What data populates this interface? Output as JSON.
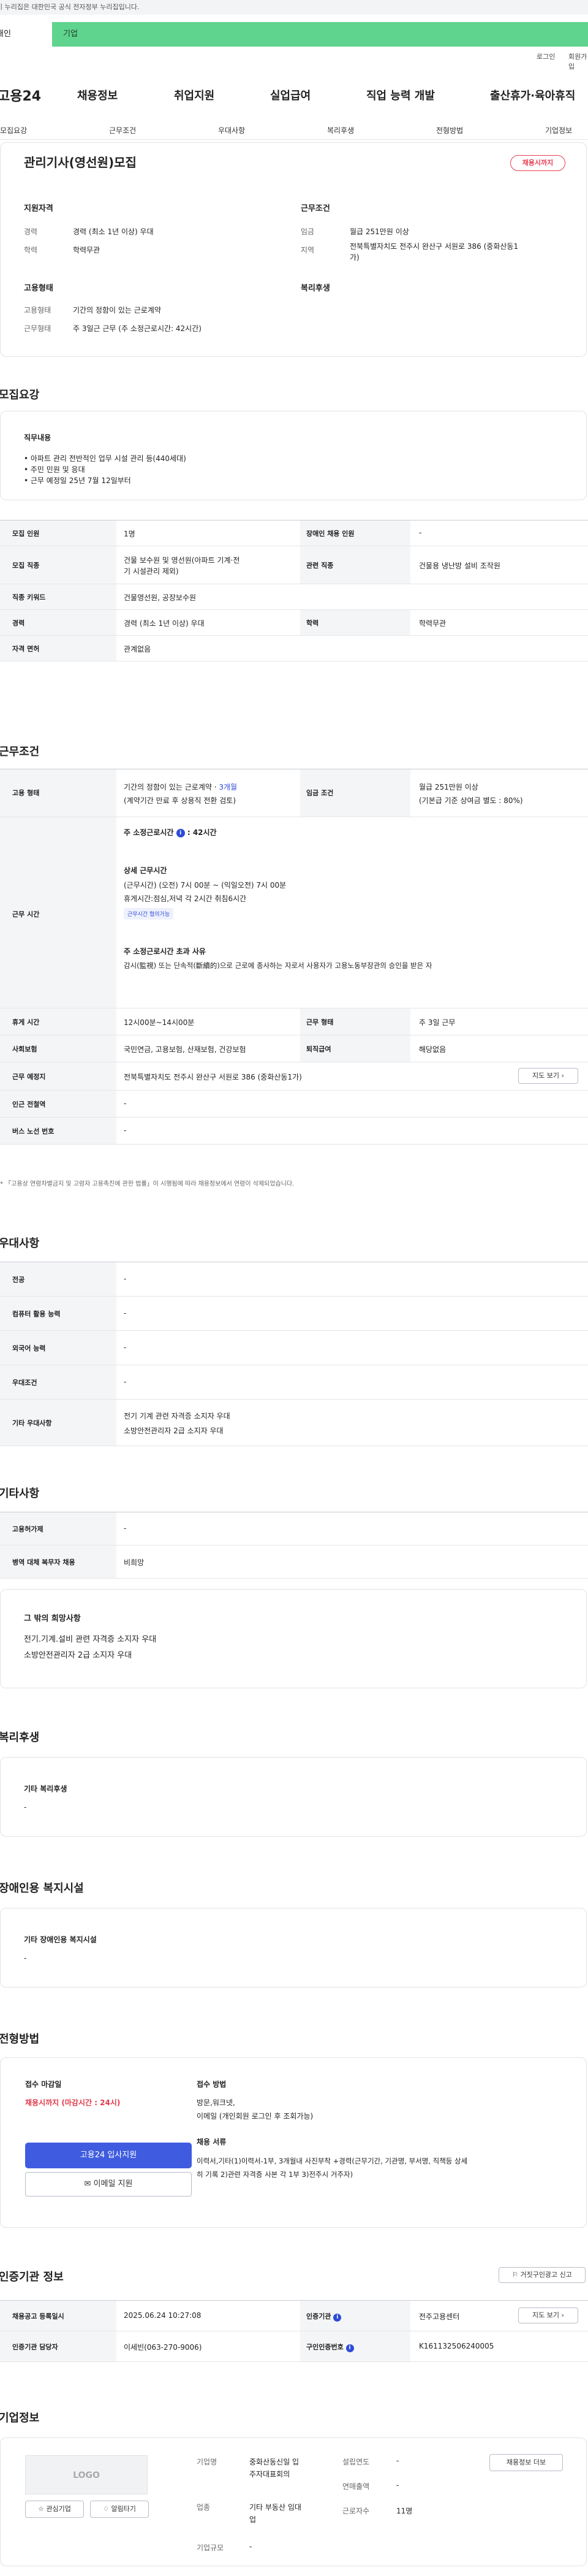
{
  "gov_banner": "이 누리집은 대한민국 공식 전자정부 누리집입니다.",
  "top_tabs": [
    "개인",
    "기업"
  ],
  "util": [
    "로그인",
    "회원가입"
  ],
  "gnb": [
    "고용24",
    "채용정보",
    "취업지원",
    "실업급여",
    "직업 능력 개발",
    "출산휴가·육아휴직"
  ],
  "subnav": [
    "모집요강",
    "근무조건",
    "우대사항",
    "복리후생",
    "전형방법",
    "기업정보"
  ],
  "summary": {
    "title": "관리기사(영선원)모집",
    "badge": "채용시까지",
    "qual_title": "지원자격",
    "qual": [
      {
        "k": "경력",
        "v": "경력 (최소 1년 이상) 우대"
      },
      {
        "k": "학력",
        "v": "학력무관"
      }
    ],
    "cond_title": "근무조건",
    "cond": [
      {
        "k": "임금",
        "v": "월급 251만원 이상"
      },
      {
        "k": "지역",
        "v1": "전북특별자치도 전주시 완산구 서원로 386 (중화산동1",
        "v2": "가)"
      }
    ],
    "emp_title": "고용형태",
    "emp": [
      {
        "k": "고용형태",
        "v": "기간의 정함이 있는 근로계약"
      },
      {
        "k": "근무형태",
        "v": "주 3일근 근무 (주 소정근로시간: 42시간)"
      }
    ],
    "welfare_title": "복리후생"
  },
  "recruit": {
    "title": "모집요강",
    "duty_title": "직무내용",
    "duties": [
      "• 아파트 관리 전반적인 업무 시설 관리 등(440세대)",
      "• 주민 민원 및 응대",
      "• 근무 예정일  25년  7월 12일부터"
    ],
    "rows": [
      {
        "k": "모집 인원",
        "v": "1명",
        "k2": "장애인 채용 인원",
        "v2": "-"
      },
      {
        "k": "모집 직종",
        "v": "건물 보수원 및 영선원(아파트 기계·전기 시설관리 제외)",
        "k2": "관련 직종",
        "v2": "건물용 냉난방 설비 조작원"
      },
      {
        "k": "직종 키워드",
        "v": "건물영선원, 공장보수원"
      },
      {
        "k": "경력",
        "v": "경력 (최소 1년 이상) 우대",
        "k2": "학력",
        "v2": "학력무관"
      },
      {
        "k": "자격 면허",
        "v": "관계없음"
      }
    ]
  },
  "work": {
    "title": "근무조건",
    "emp_k": "고용 형태",
    "emp_v1": "기간의 정함이 있는 근로계약 · ",
    "emp_v1b": "3개월",
    "emp_v2": "(계약기간 만료 후 상용직 전환 검토)",
    "wage_k": "임금 조건",
    "wage_v1": "월급 251만원 이상",
    "wage_v2": "(기본급 기준 상여금 별도 : 80%)",
    "time_k": "근무 시간",
    "time_title": "주 소정근로시간",
    "time_hours": "42시간",
    "detail_title": "상세 근무시간",
    "detail": [
      "(근무시간) (오전) 7시 00분 ~ (익일오전) 7시 00분",
      "휴게시간:점심,저녁 각 2시간 취침6시간"
    ],
    "flex_badge": "근무시간 협의가능",
    "over_title": "주 소정근로시간 초과 사유",
    "over_text": "감시(監視) 또는 단속적(斷續的)으로 근로에 종사하는 자로서 사용자가 고용노동부장관의 승인을 받은 자",
    "rows": [
      {
        "k": "휴게 시간",
        "v": "12시00분~14시00분",
        "k2": "근무 형태",
        "v2": "주 3일 근무"
      },
      {
        "k": "사회보험",
        "v": "국민연금, 고용보험, 산재보험, 건강보험",
        "k2": "퇴직급여",
        "v2": "해당없음"
      }
    ],
    "loc_k": "근무 예정지",
    "loc_v": "전북특별자치도 전주시 완산구 서원로 386 (중화산동1가)",
    "map_btn": "지도 보기",
    "station_k": "인근 전철역",
    "station_v": "-",
    "bus_k": "버스 노선 번호",
    "bus_v": "-",
    "note": "* 「고용상 연령차별금지 및 고령자 고용촉진에 관한 법률」이 시행됨에 따라 채용정보에서 연령이 삭제되었습니다."
  },
  "pref": {
    "title": "우대사항",
    "rows": [
      {
        "k": "전공",
        "v": "-"
      },
      {
        "k": "컴퓨터 활용 능력",
        "v": "-"
      },
      {
        "k": "외국어 능력",
        "v": "-"
      },
      {
        "k": "우대조건",
        "v": "-"
      }
    ],
    "etc_k": "기타 우대사항",
    "etc_v": [
      "전기 기계 관련 자격증 소지자 우대",
      "소방안전관리자 2급 소지자 우대"
    ]
  },
  "other": {
    "title": "기타사항",
    "rows": [
      {
        "k": "고용허가제",
        "v": "-"
      },
      {
        "k": "병역 대체 복무자 채용",
        "v": "비희망"
      }
    ],
    "box_title": "그 밖의 희망사항",
    "box_lines": [
      "전기.기계.설비 관련 자격증 소지자 우대",
      "소방안전관리자 2급 소지자 우대"
    ]
  },
  "welfare": {
    "title": "복리후생",
    "sub": "기타 복리후생",
    "v": "-"
  },
  "disabled": {
    "title": "장애인용 복지시설",
    "sub": "기타 장애인용 복지시설",
    "v": "-"
  },
  "selection": {
    "title": "전형방법",
    "deadline_k": "접수 마감일",
    "deadline_v": "채용시까지 (마감시간 : 24시)",
    "apply_btn": "고용24 입사지원",
    "email_btn": "이메일 지원",
    "method_k": "접수 방법",
    "method_v": [
      "방문,워크넷,",
      "이메일 (개인회원 로그인 후 조회가능)"
    ],
    "docs_k": "채용 서류",
    "docs_v": [
      "이력서,기타(1)이력서-1부, 3개월내 사진부착 +경력(근무기간, 기관명, 부서명, 직책등 상세",
      "히 기록 2)관련 자격증 사본 각 1부 3)전주시 거주자)"
    ]
  },
  "agency": {
    "title": "인증기관 정보",
    "report_btn": "거짓구인광고 신고",
    "rows": [
      {
        "k": "채용공고 등록일시",
        "v": "2025.06.24 10:27:08",
        "k2": "인증기관",
        "v2": "전주고용센터",
        "btn": "지도 보기"
      },
      {
        "k": "인증기관 담당자",
        "v": "이세빈(063-270-9006)",
        "k2": "구인인증번호",
        "v2": "K161132506240005"
      }
    ]
  },
  "company": {
    "title": "기업정보",
    "logo": "LOGO",
    "fav_btn": "관심기업",
    "alarm_btn": "알림타기",
    "name_k": "기업명",
    "name_v": [
      "중화산동신일 입",
      "주자대표회의"
    ],
    "year_k": "설립연도",
    "year_v": "-",
    "sales_k": "연매출액",
    "sales_v": "-",
    "type_k": "업종",
    "type_v": [
      "기타 부동산 임대",
      "업"
    ],
    "emp_k": "근로자수",
    "emp_v": "11명",
    "size_k": "기업규모",
    "size_v": "-",
    "hiring_btn": "채용정보 더보"
  }
}
